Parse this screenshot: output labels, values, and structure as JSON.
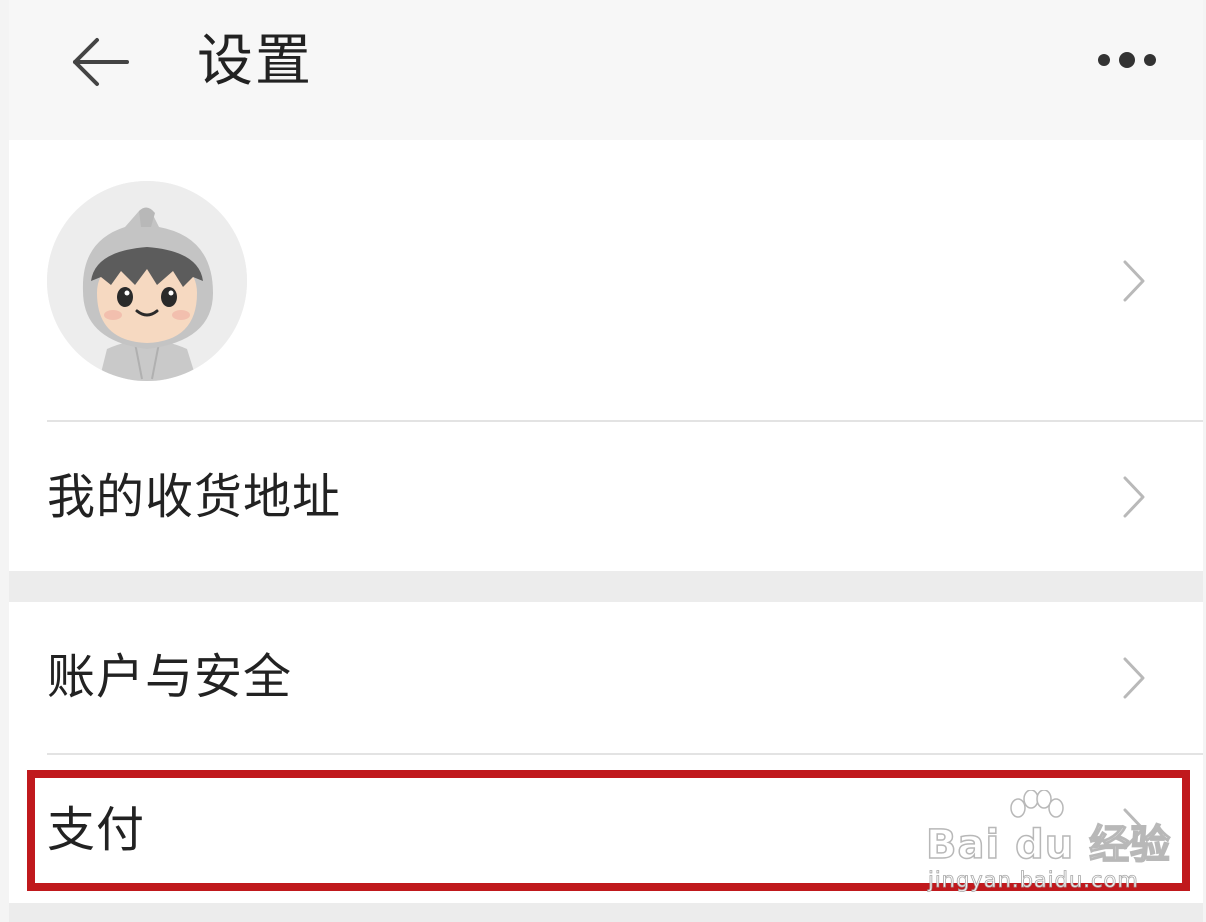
{
  "header": {
    "title": "设置",
    "back_icon": "arrow-left-icon",
    "more_icon": "more-dots-icon"
  },
  "profile": {
    "avatar_icon": "cartoon-avatar",
    "chevron_icon": "chevron-right-icon"
  },
  "menu": {
    "address_label": "我的收货地址",
    "security_label": "账户与安全",
    "pay_label": "支付"
  },
  "highlight": {
    "target": "支付",
    "color": "#c0191d"
  },
  "watermark": {
    "brand": "Bai du 经验",
    "url": "jingyan.baidu.com"
  },
  "colors": {
    "header_bg": "#f7f7f7",
    "page_bg": "#ececec",
    "row_bg": "#ffffff",
    "divider": "#e3e3e3",
    "chevron": "#b9b9b9",
    "text": "#222222"
  }
}
